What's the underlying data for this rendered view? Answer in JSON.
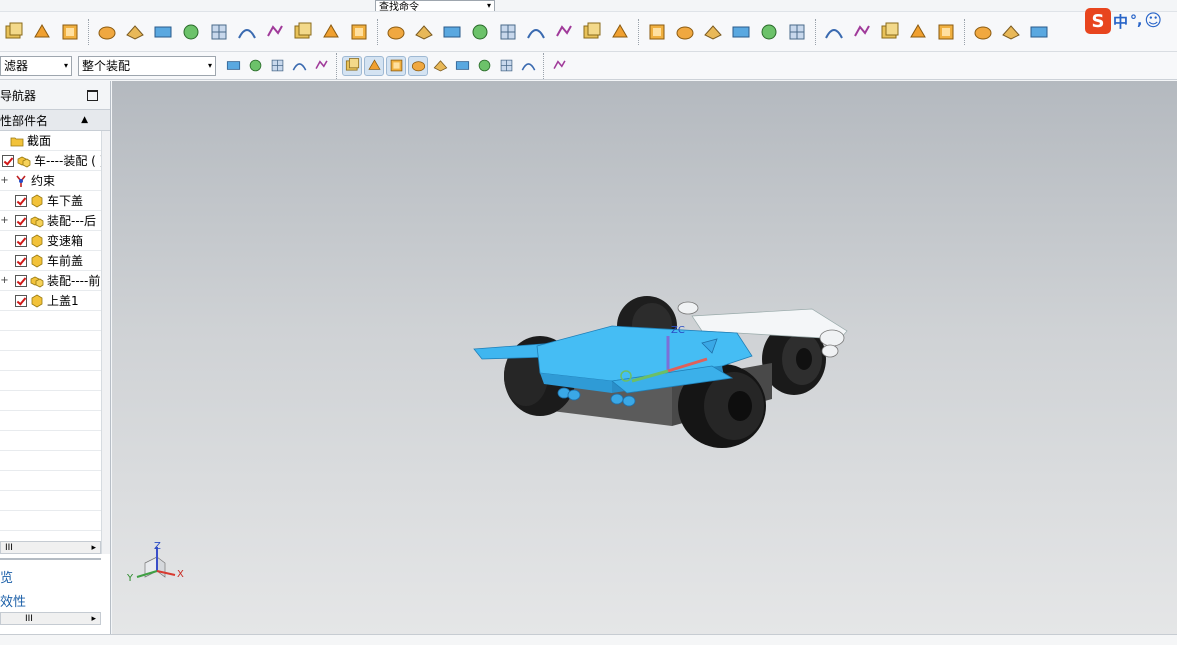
{
  "toolbar": {
    "row0_combo": "查找命令",
    "filter_combo": "滤器",
    "scope_combo": "整个装配",
    "icons_row1": [
      "new-icon",
      "open-icon",
      "save-icon",
      "extrude-icon",
      "revolve-icon",
      "block-icon",
      "cylinder-icon",
      "cone-icon",
      "sphere-icon",
      "hole-icon",
      "boss-icon",
      "pocket-icon",
      "pad-icon",
      "rib-icon",
      "slot-icon",
      "groove-icon",
      "edge-blend-icon",
      "chamfer-icon",
      "shell-icon",
      "draft-icon",
      "trim-body-icon",
      "split-body-icon",
      "sweep-icon",
      "tube-icon",
      "mirror-icon",
      "pattern-icon",
      "offset-face-icon",
      "scale-icon",
      "surface-icon",
      "mesh-icon",
      "studio-icon",
      "wrap-icon",
      "sew-icon",
      "ruled-icon",
      "swept-icon",
      "bridge-icon"
    ],
    "icons_row2": [
      "select-filter-icon",
      "snap-point-icon",
      "selection-box-icon",
      "view-icon",
      "render-icon",
      "endpoint-snap-icon",
      "midpoint-snap-icon",
      "control-point-icon",
      "intersection-snap-icon",
      "center-snap-icon",
      "quadrant-snap-icon",
      "point-on-curve-icon",
      "existing-point-icon",
      "bounded-grid-icon",
      "grid-icon"
    ]
  },
  "ime": {
    "logo": "S",
    "mode": "中",
    "punct": "°,",
    "emoji": "☺"
  },
  "navigator": {
    "title": "导航器",
    "column_header": "性部件名",
    "rows": [
      {
        "label": "截面",
        "checked": false,
        "icon": "folder-icon",
        "expandable": false,
        "indent": 0
      },
      {
        "label": "车----装配 ( )",
        "checked": true,
        "icon": "assembly-icon",
        "expandable": false,
        "indent": 0
      },
      {
        "label": "约束",
        "checked": false,
        "icon": "constraint-icon",
        "expandable": true,
        "indent": 1
      },
      {
        "label": "车下盖",
        "checked": true,
        "icon": "part-icon",
        "expandable": false,
        "indent": 1
      },
      {
        "label": "装配---后",
        "checked": true,
        "icon": "assembly-icon",
        "expandable": true,
        "indent": 1
      },
      {
        "label": "变速箱",
        "checked": true,
        "icon": "part-icon",
        "expandable": false,
        "indent": 1
      },
      {
        "label": "车前盖",
        "checked": true,
        "icon": "part-icon",
        "expandable": false,
        "indent": 1
      },
      {
        "label": "装配----前",
        "checked": true,
        "icon": "assembly-icon",
        "expandable": true,
        "indent": 1
      },
      {
        "label": "上盖1",
        "checked": true,
        "icon": "part-icon",
        "expandable": false,
        "indent": 1
      }
    ],
    "section_a": "览",
    "section_b": "效性",
    "scroll_glyph": "III"
  },
  "viewport": {
    "wcs_label": "ZC",
    "triad": {
      "z": "Z",
      "y": "Y",
      "x": "X"
    },
    "colors": {
      "model": "#3fb6f0",
      "model_dark": "#1f7fb8",
      "tire": "#1a1a1a",
      "chassis": "#5a5a5a"
    }
  }
}
